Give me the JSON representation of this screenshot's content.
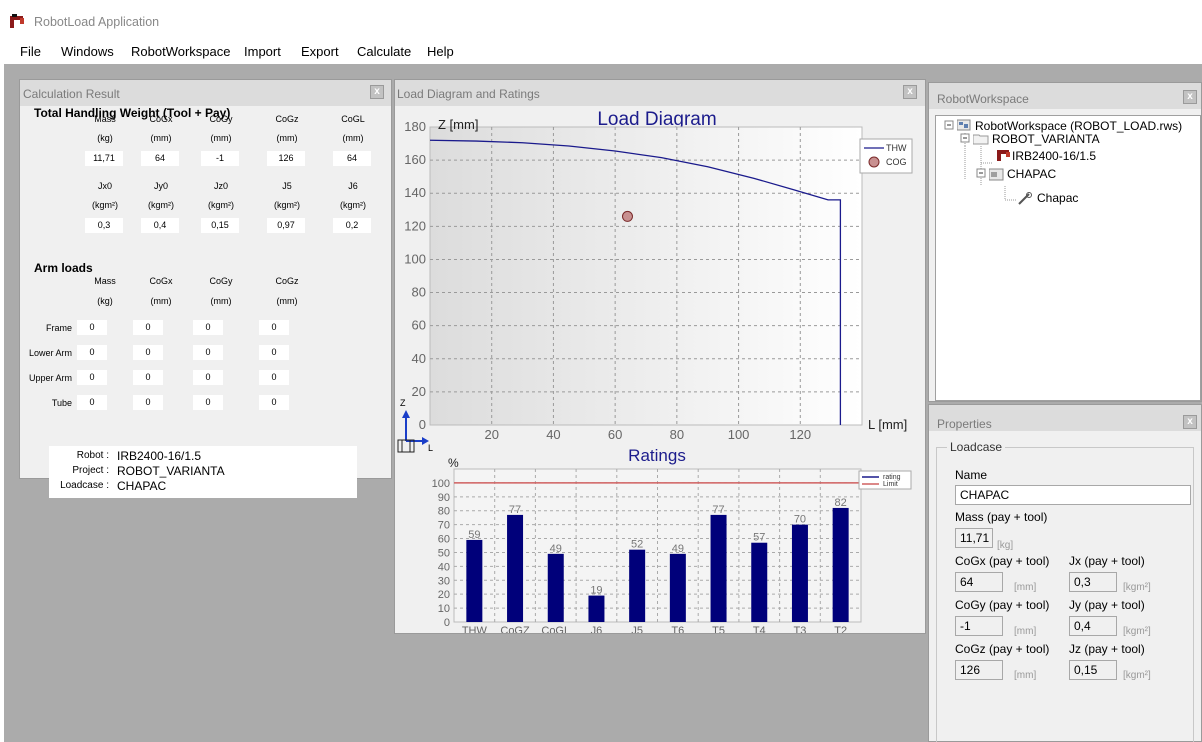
{
  "app": {
    "title": "RobotLoad Application"
  },
  "menu": [
    "File",
    "Windows",
    "RobotWorkspace",
    "Import",
    "Export",
    "Calculate",
    "Help"
  ],
  "calc": {
    "title": "Calculation Result",
    "close": "x",
    "thw": {
      "title": "Total Handling Weight (Tool + Pay)",
      "headers1": [
        "Mass",
        "CoGx",
        "CoGy",
        "CoGz",
        "CoGL"
      ],
      "units1": [
        "(kg)",
        "(mm)",
        "(mm)",
        "(mm)",
        "(mm)"
      ],
      "values1": [
        "11,71",
        "64",
        "-1",
        "126",
        "64"
      ],
      "headers2": [
        "Jx0",
        "Jy0",
        "Jz0",
        "J5",
        "J6"
      ],
      "units2": [
        "(kgm²)",
        "(kgm²)",
        "(kgm²)",
        "(kgm²)",
        "(kgm²)"
      ],
      "values2": [
        "0,3",
        "0,4",
        "0,15",
        "0,97",
        "0,2"
      ]
    },
    "arm": {
      "title": "Arm loads",
      "headers": [
        "Mass",
        "CoGx",
        "CoGy",
        "CoGz"
      ],
      "units": [
        "(kg)",
        "(mm)",
        "(mm)",
        "(mm)"
      ],
      "rows": [
        {
          "label": "Frame",
          "values": [
            "0",
            "0",
            "0",
            "0"
          ]
        },
        {
          "label": "Lower Arm",
          "values": [
            "0",
            "0",
            "0",
            "0"
          ]
        },
        {
          "label": "Upper Arm",
          "values": [
            "0",
            "0",
            "0",
            "0"
          ]
        },
        {
          "label": "Tube",
          "values": [
            "0",
            "0",
            "0",
            "0"
          ]
        }
      ]
    },
    "info": {
      "robot_label": "Robot :",
      "robot": "IRB2400-16/1.5",
      "project_label": "Project :",
      "project": "ROBOT_VARIANTA",
      "loadcase_label": "Loadcase :",
      "loadcase": "CHAPAC"
    }
  },
  "load": {
    "title": "Load Diagram and Ratings",
    "close": "x",
    "diagram_title": "Load Diagram",
    "ratings_title": "Ratings",
    "axis_z": "Z",
    "axis_l": "L"
  },
  "rw": {
    "title": "RobotWorkspace",
    "close": "x",
    "tree": [
      "RobotWorkspace (ROBOT_LOAD.rws)",
      "ROBOT_VARIANTA",
      "IRB2400-16/1.5",
      "CHAPAC",
      "Chapac"
    ]
  },
  "props": {
    "title": "Properties",
    "close": "x",
    "group": "Loadcase",
    "name_label": "Name",
    "name": "CHAPAC",
    "mass_label": "Mass (pay + tool)",
    "mass": "11,71",
    "mass_unit": "[kg]",
    "cogx_label": "CoGx (pay + tool)",
    "cogx": "64",
    "cogx_unit": "[mm]",
    "jx_label": "Jx (pay + tool)",
    "jx": "0,3",
    "jx_unit": "[kgm²]",
    "cogy_label": "CoGy (pay + tool)",
    "cogy": "-1",
    "cogy_unit": "[mm]",
    "jy_label": "Jy (pay + tool)",
    "jy": "0,4",
    "jy_unit": "[kgm²]",
    "cogz_label": "CoGz (pay + tool)",
    "cogz": "126",
    "cogz_unit": "[mm]",
    "jz_label": "Jz (pay + tool)",
    "jz": "0,15",
    "jz_unit": "[kgm²]"
  },
  "chart_data": [
    {
      "type": "line",
      "title": "Load Diagram",
      "xlabel": "L [mm]",
      "ylabel": "Z [mm]",
      "xlim": [
        0,
        140
      ],
      "ylim": [
        0,
        180
      ],
      "xticks": [
        "20",
        "40",
        "60",
        "80",
        "100",
        "120"
      ],
      "yticks": [
        "0",
        "20",
        "40",
        "60",
        "80",
        "100",
        "120",
        "140",
        "160",
        "180"
      ],
      "legend": [
        "THW",
        "COG"
      ],
      "legend_position": "top-right",
      "grid": true,
      "series": [
        {
          "name": "THW",
          "x": [
            0,
            15,
            30,
            45,
            60,
            75,
            90,
            105,
            118,
            129,
            133,
            133
          ],
          "y": [
            172,
            171.5,
            170.5,
            168.5,
            165.5,
            161.5,
            156,
            149,
            142,
            136,
            136,
            0
          ]
        },
        {
          "name": "COG",
          "x": [
            64
          ],
          "y": [
            126
          ]
        }
      ],
      "colors": {
        "line": "#1a1a8c",
        "marker_fill": "#c89090",
        "marker_edge": "#7a2a2a"
      }
    },
    {
      "type": "bar",
      "title": "Ratings",
      "ylabel": "%",
      "ylim": [
        0,
        110
      ],
      "yticks": [
        "0",
        "10",
        "20",
        "30",
        "40",
        "50",
        "60",
        "70",
        "80",
        "90",
        "100"
      ],
      "categories": [
        "THW",
        "CoGZ",
        "CoGL",
        "J6",
        "J5",
        "T6",
        "T5",
        "T4",
        "T3",
        "T2"
      ],
      "labels": [
        "59",
        "77",
        "49",
        "19",
        "52",
        "49",
        "77",
        "57",
        "70",
        "82"
      ],
      "values": [
        59,
        77,
        49,
        19,
        52,
        49,
        77,
        57,
        70,
        82
      ],
      "limit": 100,
      "legend": [
        "rating",
        "Limit"
      ],
      "legend_position": "top-right",
      "grid": true,
      "colors": {
        "bar": "#00007a",
        "limit": "#d06060"
      }
    }
  ]
}
